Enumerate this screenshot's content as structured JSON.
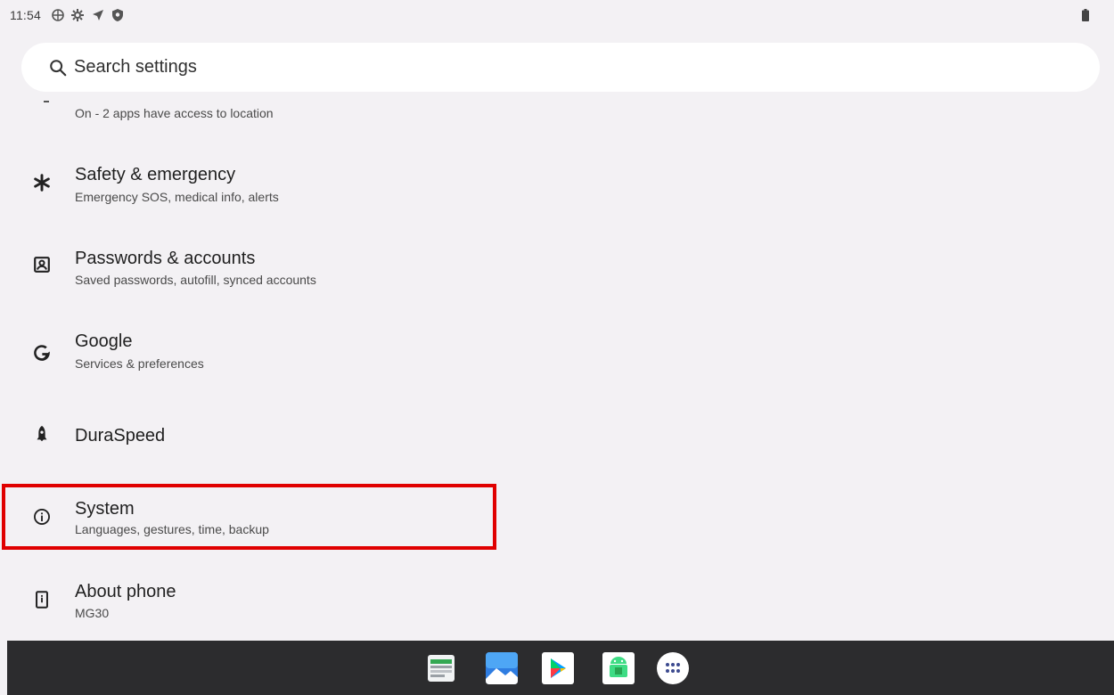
{
  "status_bar": {
    "time": "11:54",
    "icons": [
      "vpn-globe-icon",
      "settings-gear-icon",
      "location-arrow-icon",
      "shield-icon",
      "battery-icon"
    ]
  },
  "search": {
    "placeholder": "Search settings"
  },
  "settings": {
    "partial_item_subtitle": "On - 2 apps have access to location",
    "items": [
      {
        "title": "Safety & emergency",
        "subtitle": "Emergency SOS, medical info, alerts",
        "icon": "asterisk-icon"
      },
      {
        "title": "Passwords & accounts",
        "subtitle": "Saved passwords, autofill, synced accounts",
        "icon": "account-box-icon"
      },
      {
        "title": "Google",
        "subtitle": "Services & preferences",
        "icon": "google-g-icon"
      },
      {
        "title": "DuraSpeed",
        "subtitle": "",
        "icon": "rocket-icon"
      },
      {
        "title": "System",
        "subtitle": "Languages, gestures, time, backup",
        "icon": "info-icon",
        "highlighted": true
      },
      {
        "title": "About phone",
        "subtitle": "MG30",
        "icon": "phone-icon"
      }
    ]
  },
  "taskbar": {
    "apps": [
      "sheets-app-icon",
      "gallery-app-icon",
      "play-store-icon",
      "android-app-icon",
      "app-drawer-icon"
    ]
  },
  "colors": {
    "background": "#f3f1f4",
    "highlight": "#e00000",
    "taskbar": "#2c2c2e"
  }
}
